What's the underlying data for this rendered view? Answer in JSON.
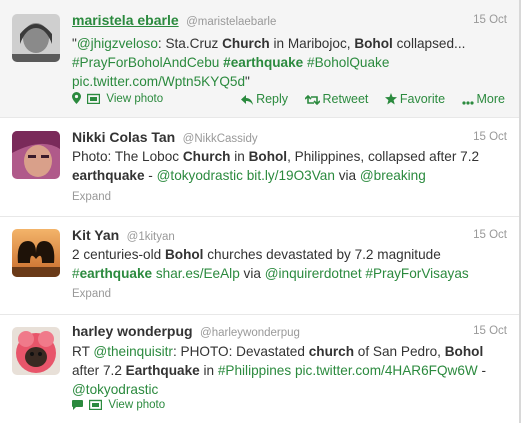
{
  "tweets": [
    {
      "name": "maristela ebarle",
      "handle": "@maristelaebarle",
      "time": "15 Oct",
      "text": [
        {
          "t": "\"",
          "s": ""
        },
        {
          "t": "@jhigzveloso",
          "s": "g"
        },
        {
          "t": ": Sta.Cruz ",
          "s": ""
        },
        {
          "t": "Church",
          "s": "b"
        },
        {
          "t": " in Maribojoc, ",
          "s": ""
        },
        {
          "t": "Bohol",
          "s": "b"
        },
        {
          "t": " collapsed... ",
          "s": ""
        },
        {
          "t": "#PrayForBoholAndCebu",
          "s": "g"
        },
        {
          "t": " ",
          "s": ""
        },
        {
          "t": "#earthquake",
          "s": "gb"
        },
        {
          "t": " ",
          "s": ""
        },
        {
          "t": "#BoholQuake",
          "s": "g"
        },
        {
          "t": " ",
          "s": ""
        },
        {
          "t": "pic.twitter.com/Wptn5KYQ5d",
          "s": "g"
        },
        {
          "t": "\"",
          "s": ""
        }
      ],
      "footer": "View photo",
      "actions": {
        "reply": "Reply",
        "retweet": "Retweet",
        "favorite": "Favorite",
        "more": "More"
      }
    },
    {
      "name": "Nikki Colas Tan",
      "handle": "@NikkCassidy",
      "time": "15 Oct",
      "text": [
        {
          "t": "Photo: The Loboc ",
          "s": ""
        },
        {
          "t": "Church",
          "s": "b"
        },
        {
          "t": " in ",
          "s": ""
        },
        {
          "t": "Bohol",
          "s": "b"
        },
        {
          "t": ", Philippines, collapsed after 7.2 ",
          "s": ""
        },
        {
          "t": "earthquake",
          "s": "b"
        },
        {
          "t": " - ",
          "s": ""
        },
        {
          "t": "@tokyodrastic",
          "s": "g"
        },
        {
          "t": " ",
          "s": ""
        },
        {
          "t": "bit.ly/19O3Van",
          "s": "g"
        },
        {
          "t": " via ",
          "s": ""
        },
        {
          "t": "@breaking",
          "s": "g"
        }
      ],
      "footer": "Expand"
    },
    {
      "name": "Kit Yan",
      "handle": "@1kityan",
      "time": "15 Oct",
      "text": [
        {
          "t": "2 centuries-old ",
          "s": ""
        },
        {
          "t": "Bohol",
          "s": "b"
        },
        {
          "t": " churches devastated by 7.2 magnitude ",
          "s": ""
        },
        {
          "t": "#",
          "s": "g"
        },
        {
          "t": "earthquake",
          "s": "gb"
        },
        {
          "t": " ",
          "s": ""
        },
        {
          "t": "shar.es/EeAlp",
          "s": "g"
        },
        {
          "t": " via ",
          "s": ""
        },
        {
          "t": "@inquirerdotnet",
          "s": "g"
        },
        {
          "t": " ",
          "s": ""
        },
        {
          "t": "#PrayForVisayas",
          "s": "g"
        }
      ],
      "footer": "Expand"
    },
    {
      "name": "harley wonderpug",
      "handle": "@harleywonderpug",
      "time": "15 Oct",
      "text": [
        {
          "t": "RT ",
          "s": ""
        },
        {
          "t": "@theinquisitr",
          "s": "g"
        },
        {
          "t": ": PHOTO: Devastated ",
          "s": ""
        },
        {
          "t": "church",
          "s": "b"
        },
        {
          "t": " of San Pedro, ",
          "s": ""
        },
        {
          "t": "Bohol",
          "s": "b"
        },
        {
          "t": " after 7.2 ",
          "s": ""
        },
        {
          "t": "Earthquake",
          "s": "b"
        },
        {
          "t": " in ",
          "s": ""
        },
        {
          "t": "#Philippines",
          "s": "g"
        },
        {
          "t": " ",
          "s": ""
        },
        {
          "t": "pic.twitter.com/4HAR6FQw6W",
          "s": "g"
        },
        {
          "t": " - ",
          "s": ""
        },
        {
          "t": "@tokyodrastic",
          "s": "g"
        }
      ],
      "footer": "View photo"
    }
  ],
  "colors": {
    "accent": "#2b8a3e",
    "muted": "#999999",
    "text": "#333333",
    "highlight_bg": "#f5f5f5"
  },
  "icons": {
    "location": "map-pin-icon",
    "photo": "photo-icon",
    "conversation": "speech-bubble-icon",
    "reply": "reply-arrow-icon",
    "retweet": "retweet-icon",
    "favorite": "star-icon",
    "more": "more-dots-icon"
  }
}
